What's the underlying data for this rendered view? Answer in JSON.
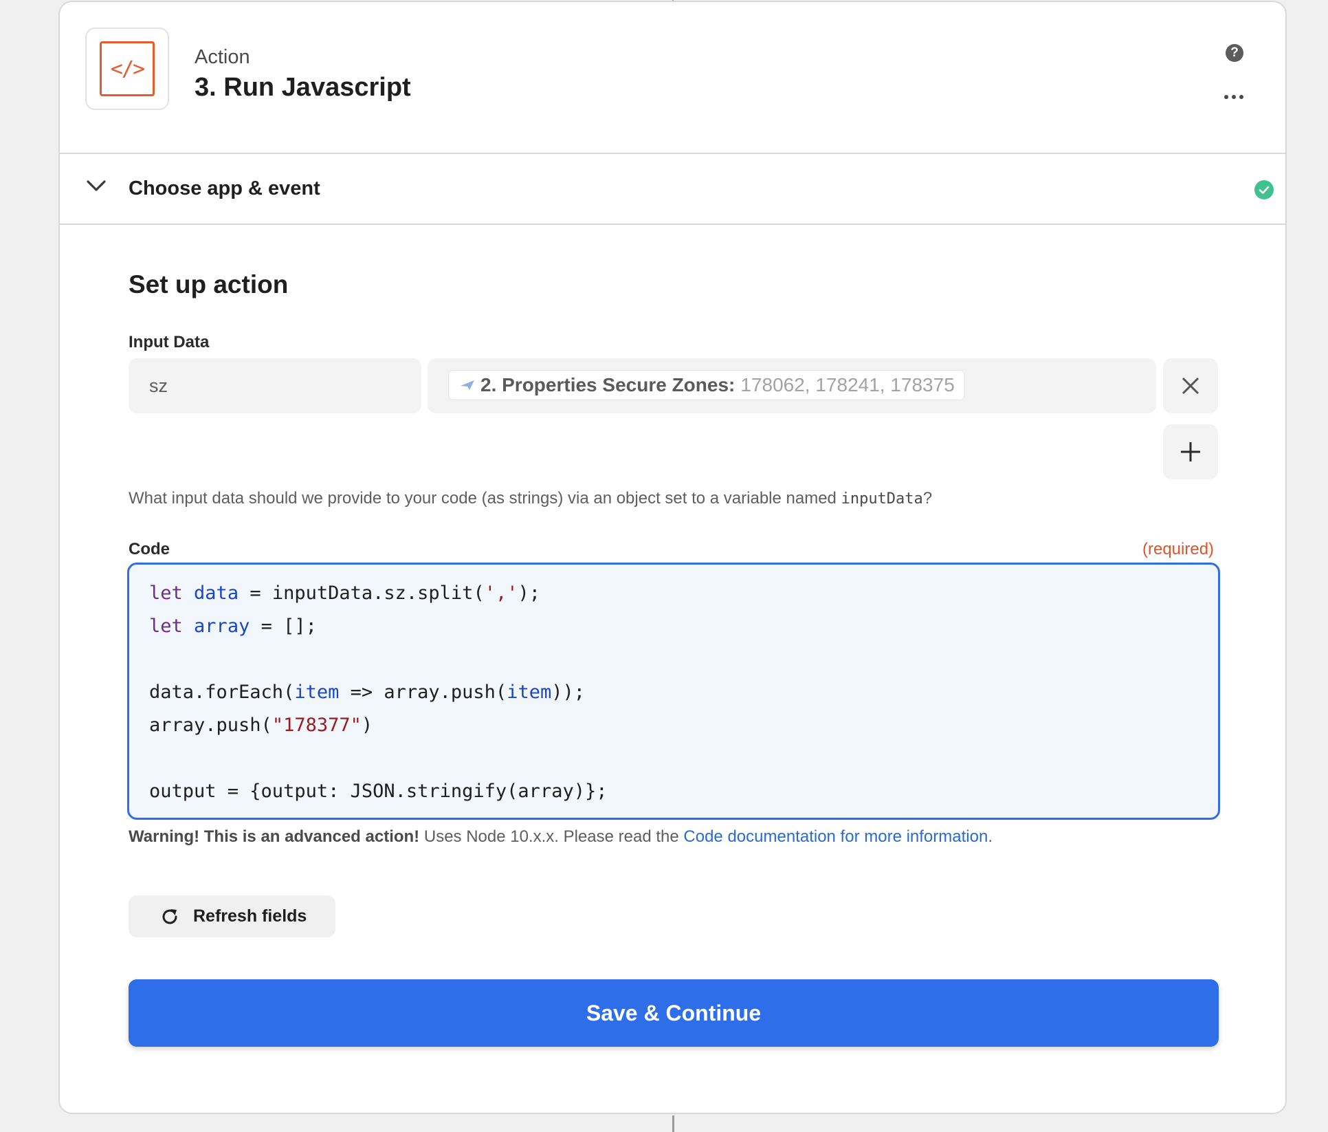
{
  "step": {
    "kind": "Action",
    "title": "3. Run Javascript",
    "icon": "code-icon",
    "icon_text": "</>",
    "icon_color": "#e8592b"
  },
  "choose_section": {
    "title": "Choose app & event",
    "status": "complete"
  },
  "setup": {
    "title": "Set up action",
    "input_data_label": "Input Data",
    "rows": [
      {
        "key": "sz",
        "value_label": "2. Properties Secure Zones:",
        "value_preview": "178062, 178241, 178375"
      }
    ],
    "help_prefix": "What input data should we provide to your code (as strings) via an object set to a variable named ",
    "help_code": "inputData",
    "help_suffix": "?",
    "code_label": "Code",
    "required_text": "(required)",
    "code_lines": [
      [
        {
          "t": "let",
          "c": "kw"
        },
        {
          "t": " "
        },
        {
          "t": "data",
          "c": "var"
        },
        {
          "t": " = inputData.sz.split("
        },
        {
          "t": "','",
          "c": "str"
        },
        {
          "t": ");"
        }
      ],
      [
        {
          "t": "let",
          "c": "kw"
        },
        {
          "t": " "
        },
        {
          "t": "array",
          "c": "var"
        },
        {
          "t": " = [];"
        }
      ],
      [],
      [
        {
          "t": "data.forEach("
        },
        {
          "t": "item",
          "c": "var"
        },
        {
          "t": " => array.push("
        },
        {
          "t": "item",
          "c": "var"
        },
        {
          "t": "));"
        }
      ],
      [
        {
          "t": "array.push("
        },
        {
          "t": "\"178377\"",
          "c": "str"
        },
        {
          "t": ")"
        }
      ],
      [],
      [
        {
          "t": "output = {output: JSON.stringify(array)};"
        }
      ]
    ],
    "warning_bold": "Warning! This is an advanced action!",
    "warning_text": " Uses Node 10.x.x. Please read the ",
    "warning_link": "Code documentation for more information",
    "warning_end": ".",
    "refresh_label": "Refresh fields",
    "save_label": "Save & Continue"
  },
  "colors": {
    "primary": "#2e6ee8",
    "required": "#d8562a",
    "success": "#3fc290",
    "link": "#2a6ad8"
  }
}
